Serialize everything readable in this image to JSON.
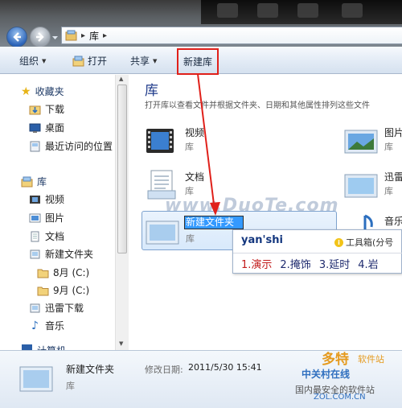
{
  "address": {
    "crumbs": [
      "库"
    ]
  },
  "toolbar": {
    "organize": "组织",
    "open": "打开",
    "share": "共享",
    "new_library": "新建库"
  },
  "sidebar": {
    "favorites": "收藏夹",
    "fav_items": [
      "下载",
      "桌面",
      "最近访问的位置"
    ],
    "libraries": "库",
    "lib_items": [
      "视频",
      "图片",
      "文档",
      "新建文件夹"
    ],
    "drives": [
      "8月 (C:)",
      "9月 (C:)"
    ],
    "extra_items": [
      "迅雷下载",
      "音乐"
    ],
    "computer": "计算机"
  },
  "main": {
    "title": "库",
    "description": "打开库以查看文件并根据文件夹、日期和其他属性排列这些文件",
    "tiles": [
      {
        "name": "视频",
        "sub": "库"
      },
      {
        "name": "图片",
        "sub": "库"
      },
      {
        "name": "文档",
        "sub": "库"
      },
      {
        "name": "迅雷",
        "sub": "库"
      },
      {
        "name": "音乐",
        "sub": "库"
      }
    ],
    "new_tile": {
      "rename_value": "新建文件夹",
      "sub": "库"
    }
  },
  "ime": {
    "composition": "yan'shi",
    "tools": "工具箱(分号",
    "candidates": [
      "1.演示",
      "2.掩饰",
      "3.延时",
      "4.岩"
    ]
  },
  "details": {
    "name": "新建文件夹",
    "modified_label": "修改日期:",
    "modified_value": "2011/5/30 15:41",
    "type": "库"
  },
  "watermarks": {
    "center": "www.DuoTe.com",
    "corner_brand": "多特",
    "corner_sub": "软件站",
    "corner_site": "中关村在线",
    "corner_line": "国内最安全的软件站",
    "corner_url": "ZOL.COM.CN"
  },
  "colors": {
    "highlight_box": "#e0201a",
    "arrow": "#e0201a",
    "selection": "#3399ff"
  }
}
